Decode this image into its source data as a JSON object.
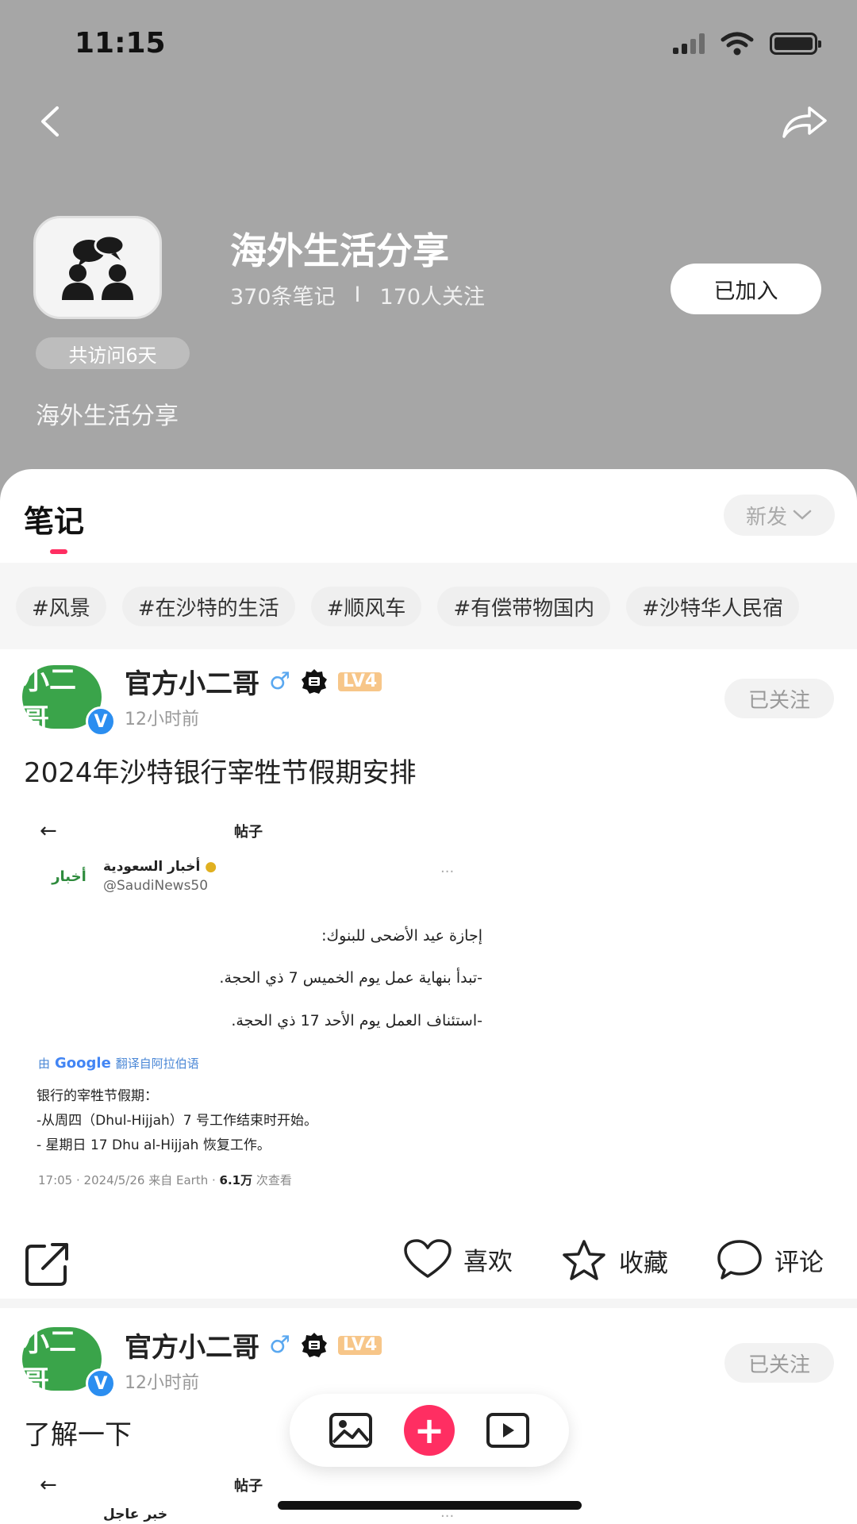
{
  "status": {
    "time": "11:15"
  },
  "group": {
    "name": "海外生活分享",
    "notes_count": "370条笔记",
    "separator": "I",
    "followers": "170人关注",
    "joined_label": "已加入",
    "visit_badge": "共访问6天",
    "description": "海外生活分享"
  },
  "notes": {
    "title": "笔记",
    "sort_label": "新发",
    "tags": [
      "#风景",
      "#在沙特的生活",
      "#顺风车",
      "#有偿带物国内",
      "#沙特华人民宿"
    ]
  },
  "posts": [
    {
      "author": "官方小二哥",
      "avatar_text": "小二哥",
      "gender": "♂",
      "level": "LV4",
      "time": "12小时前",
      "follow_label": "已关注",
      "text": "2024年沙特银行宰牲节假期安排",
      "screenshot": {
        "back": "←",
        "title": "帖子",
        "account_name": "أخبار السعودية",
        "account_logo": "أخبار",
        "handle": "@SaudiNews50",
        "dots": "···",
        "arabic_lines": [
          "إجازة عيد الأضحى للبنوك:",
          "-تبدأ بنهاية عمل يوم الخميس 7 ذي الحجة.",
          "-استئناف العمل يوم الأحد 17 ذي الحجة."
        ],
        "translate_prefix": "由",
        "translate_brand": "Google",
        "translate_suffix": "翻译自阿拉伯语",
        "translated_lines": [
          "银行的宰牲节假期：",
          "-从周四（Dhul-Hijjah）7 号工作结束时开始。",
          "- 星期日 17 Dhu al-Hijjah 恢复工作。"
        ],
        "meta_prefix": "17:05 · 2024/5/26 来自 Earth · ",
        "meta_views": "6.1万",
        "meta_suffix": " 次查看"
      }
    },
    {
      "author": "官方小二哥",
      "avatar_text": "小二哥",
      "gender": "♂",
      "level": "LV4",
      "time": "12小时前",
      "follow_label": "已关注",
      "text": "了解一下",
      "screenshot": {
        "back": "←",
        "title": "帖子",
        "account_name": "خبر عاجل",
        "dots": "···"
      }
    }
  ],
  "actions": {
    "like": "喜欢",
    "collect": "收藏",
    "comment": "评论"
  },
  "colors": {
    "header_bg": "#a6a6a6",
    "accent": "#ff2e62",
    "verified": "#2b8ef0",
    "avatar_green": "#3aa44a"
  }
}
